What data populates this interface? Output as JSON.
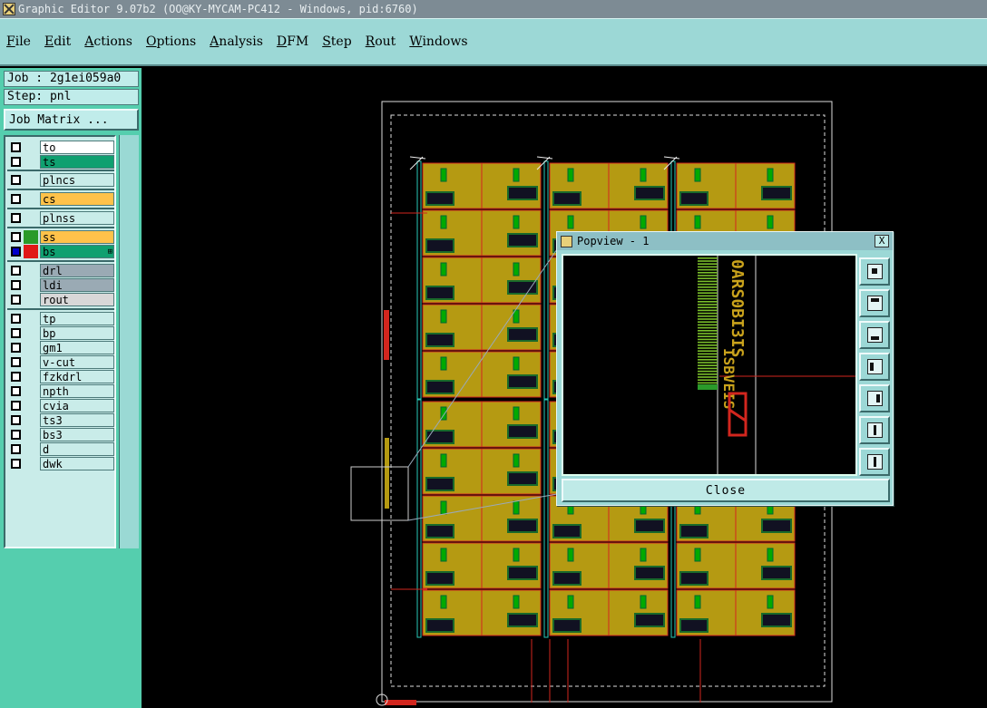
{
  "window": {
    "title": "Graphic Editor 9.07b2 (OO@KY-MYCAM-PC412 - Windows, pid:6760)"
  },
  "menu": [
    "File",
    "Edit",
    "Actions",
    "Options",
    "Analysis",
    "DFM",
    "Step",
    "Rout",
    "Windows"
  ],
  "job": {
    "label": "Job : 2g1ei059a0"
  },
  "step": {
    "label": "Step: pnl"
  },
  "job_matrix_button": "Job Matrix ...",
  "layers": [
    {
      "name": "to",
      "color": "#ffffff",
      "checked": false
    },
    {
      "name": "ts",
      "color": "#0fa070",
      "checked": false
    },
    {
      "name": "plncs",
      "color": "#c9ece9",
      "checked": false
    },
    {
      "name": "cs",
      "color": "#ffc24a",
      "checked": false
    },
    {
      "name": "plnss",
      "color": "#c9ece9",
      "checked": false
    },
    {
      "name": "ss",
      "color": "#ffc24a",
      "checked": false,
      "swatch": "#2a9a2a"
    },
    {
      "name": "bs",
      "color": "#0fa070",
      "checked": true,
      "swatch": "#e01818"
    },
    {
      "name": "drl",
      "color": "#9aaab4",
      "checked": false
    },
    {
      "name": "ldi",
      "color": "#9aaab4",
      "checked": false
    },
    {
      "name": "rout",
      "color": "#d8d8d8",
      "checked": false
    },
    {
      "name": "tp",
      "color": "#c9ece9",
      "checked": false
    },
    {
      "name": "bp",
      "color": "#c9ece9",
      "checked": false
    },
    {
      "name": "gm1",
      "color": "#c9ece9",
      "checked": false
    },
    {
      "name": "v-cut",
      "color": "#c9ece9",
      "checked": false
    },
    {
      "name": "fzkdrl",
      "color": "#c9ece9",
      "checked": false
    },
    {
      "name": "npth",
      "color": "#c9ece9",
      "checked": false
    },
    {
      "name": "cvia",
      "color": "#c9ece9",
      "checked": false
    },
    {
      "name": "ts3",
      "color": "#c9ece9",
      "checked": false
    },
    {
      "name": "bs3",
      "color": "#c9ece9",
      "checked": false
    },
    {
      "name": "d",
      "color": "#c9ece9",
      "checked": false
    },
    {
      "name": "dwk",
      "color": "#c9ece9",
      "checked": false
    }
  ],
  "popview": {
    "title": "Popview - 1",
    "close_x": "X",
    "close_label": "Close",
    "tools": [
      "zoom-fit-icon",
      "pan-up-icon",
      "pan-down-icon",
      "pan-left-icon",
      "pan-right-icon",
      "zoom-in-icon",
      "zoom-out-icon"
    ],
    "sample_text_1": "0ARS0BI3IS",
    "sample_text_2": "ISBVEIS"
  },
  "colors": {
    "board": "#b59a12",
    "trace": "#d2261e",
    "outline": "#28c8b8",
    "pad": "#1a6a2a",
    "menu_bg": "#9cd8d6",
    "panel_bg": "#55ceae"
  }
}
